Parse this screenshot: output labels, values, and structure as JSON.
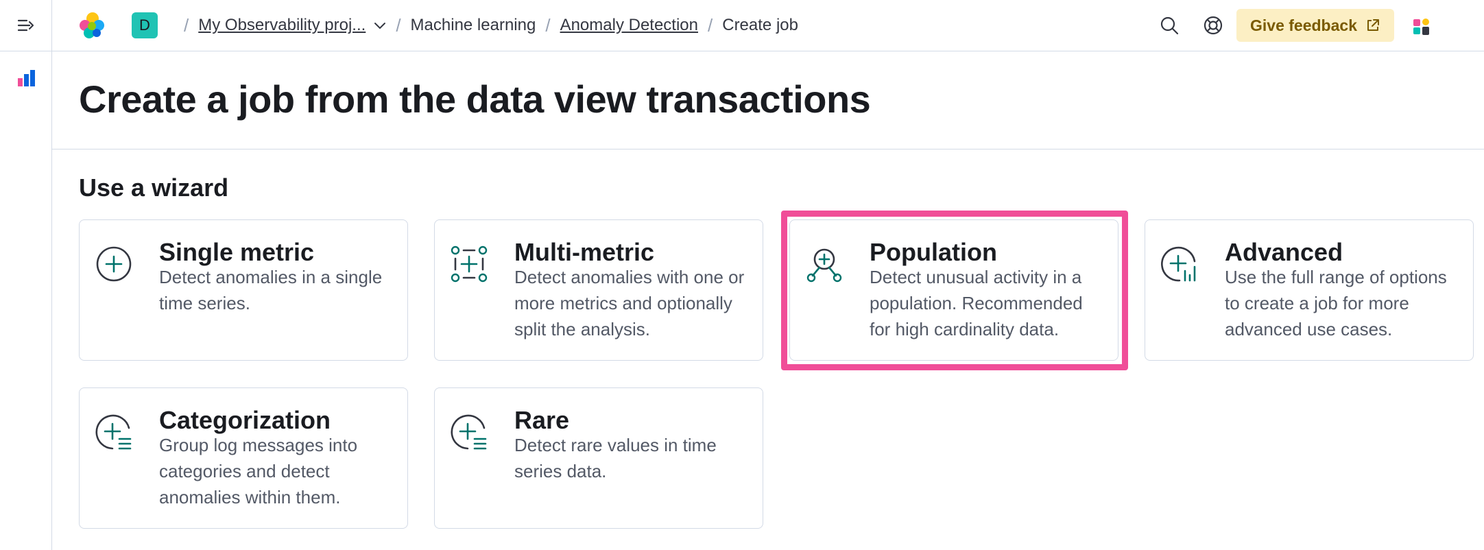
{
  "header": {
    "space_initial": "D",
    "breadcrumbs": {
      "project": "My Observability proj...",
      "machine_learning": "Machine learning",
      "anomaly_detection": "Anomaly Detection",
      "current": "Create job"
    },
    "feedback_label": "Give feedback"
  },
  "page": {
    "title": "Create a job from the data view transactions",
    "section_title": "Use a wizard"
  },
  "wizards": [
    {
      "title": "Single metric",
      "description": "Detect anomalies in a single time series.",
      "icon": "plus-circle-icon"
    },
    {
      "title": "Multi-metric",
      "description": "Detect anomalies with one or more metrics and optionally split the analysis.",
      "icon": "multi-metric-icon"
    },
    {
      "title": "Population",
      "description": "Detect unusual activity in a population. Recommended for high cardinality data.",
      "icon": "population-icon"
    },
    {
      "title": "Advanced",
      "description": "Use the full range of options to create a job for more advanced use cases.",
      "icon": "advanced-icon"
    },
    {
      "title": "Categorization",
      "description": "Group log messages into categories and detect anomalies within them.",
      "icon": "categorization-icon"
    },
    {
      "title": "Rare",
      "description": "Detect rare values in time series data.",
      "icon": "rare-icon"
    }
  ],
  "colors": {
    "accent_teal": "#00726b",
    "highlight_pink": "#f04e98",
    "feedback_bg": "#fcefc4",
    "avatar_bg": "#20c3b4"
  }
}
